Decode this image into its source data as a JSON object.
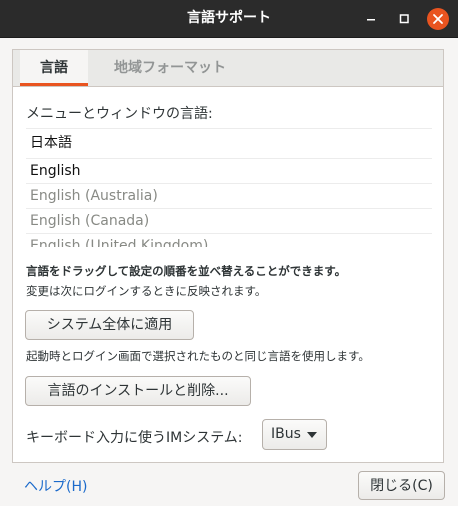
{
  "window": {
    "title": "言語サポート",
    "accent_color": "#e95420",
    "titlebar_color": "#2b2b2b"
  },
  "controls": {
    "minimize_icon": "minimize-icon",
    "maximize_icon": "maximize-icon",
    "close_icon": "close-icon"
  },
  "tabs": [
    {
      "label": "言語",
      "active": true
    },
    {
      "label": "地域フォーマット",
      "active": false
    }
  ],
  "language_section": {
    "label": "メニューとウィンドウの言語:",
    "languages": [
      {
        "name": "日本語"
      },
      {
        "name": "English"
      },
      {
        "name": "English (Australia)"
      },
      {
        "name": "English (Canada)"
      },
      {
        "name": "English (United Kingdom)"
      }
    ],
    "drag_hint": "言語をドラッグして設定の順番を並べ替えることができます。",
    "relogin_hint": "変更は次にログインするときに反映されます。",
    "apply_button": "システム全体に適用",
    "startup_hint": "起動時とログイン画面で選択されたものと同じ言語を使用します。",
    "install_button": "言語のインストールと削除..."
  },
  "im_system": {
    "label": "キーボード入力に使うIMシステム:",
    "selected": "IBus"
  },
  "footer": {
    "help_link": "ヘルプ(H)",
    "close_button": "閉じる(C)",
    "link_color": "#1b6acb"
  }
}
